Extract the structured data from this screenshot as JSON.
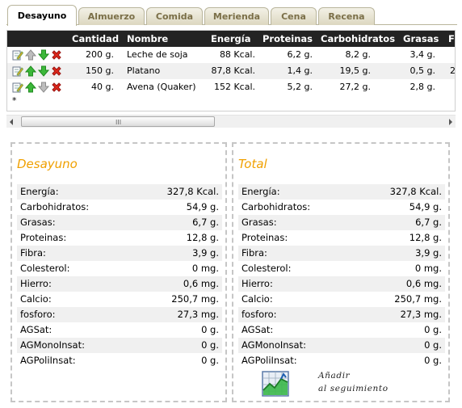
{
  "tabs": [
    {
      "label": "Desayuno",
      "active": true
    },
    {
      "label": "Almuerzo",
      "active": false
    },
    {
      "label": "Comida",
      "active": false
    },
    {
      "label": "Merienda",
      "active": false
    },
    {
      "label": "Cena",
      "active": false
    },
    {
      "label": "Recena",
      "active": false
    }
  ],
  "grid": {
    "columns": [
      "Cantidad",
      "Nombre",
      "Energía",
      "Proteinas",
      "Carbohidratos",
      "Grasas",
      "F"
    ],
    "rows": [
      {
        "cantidad": "200 g.",
        "nombre": "Leche de soja",
        "energia": "88 Kcal.",
        "proteinas": "6,2 g.",
        "carbohidratos": "8,2 g.",
        "grasas": "3,4 g.",
        "extra": "",
        "up_enabled": false,
        "down_enabled": true
      },
      {
        "cantidad": "150 g.",
        "nombre": "Platano",
        "energia": "87,8 Kcal.",
        "proteinas": "1,4 g.",
        "carbohidratos": "19,5 g.",
        "grasas": "0,5 g.",
        "extra": "2",
        "up_enabled": true,
        "down_enabled": true
      },
      {
        "cantidad": "40 g.",
        "nombre": "Avena (Quaker)",
        "energia": "152 Kcal.",
        "proteinas": "5,2 g.",
        "carbohidratos": "27,2 g.",
        "grasas": "2,8 g.",
        "extra": "",
        "up_enabled": true,
        "down_enabled": false
      }
    ],
    "new_row_marker": "*",
    "scroll_grip": "III",
    "icons": [
      "edit-icon",
      "arrow-up-icon",
      "arrow-down-icon",
      "delete-icon"
    ]
  },
  "summary_meal": {
    "title": "Desayuno",
    "rows": [
      {
        "label": "Energía:",
        "value": "327,8 Kcal."
      },
      {
        "label": "Carbohidratos:",
        "value": "54,9 g."
      },
      {
        "label": "Grasas:",
        "value": "6,7 g."
      },
      {
        "label": "Proteinas:",
        "value": "12,8 g."
      },
      {
        "label": "Fibra:",
        "value": "3,9 g."
      },
      {
        "label": "Colesterol:",
        "value": "0 mg."
      },
      {
        "label": "Hierro:",
        "value": "0,6 mg."
      },
      {
        "label": "Calcio:",
        "value": "250,7 mg."
      },
      {
        "label": "fosforo:",
        "value": "27,3 mg."
      },
      {
        "label": "AGSat:",
        "value": "0 g."
      },
      {
        "label": "AGMonoInsat:",
        "value": "0 g."
      },
      {
        "label": "AGPoliInsat:",
        "value": "0 g."
      }
    ]
  },
  "summary_total": {
    "title": "Total",
    "rows": [
      {
        "label": "Energía:",
        "value": "327,8 Kcal."
      },
      {
        "label": "Carbohidratos:",
        "value": "54,9 g."
      },
      {
        "label": "Grasas:",
        "value": "6,7 g."
      },
      {
        "label": "Proteinas:",
        "value": "12,8 g."
      },
      {
        "label": "Fibra:",
        "value": "3,9 g."
      },
      {
        "label": "Colesterol:",
        "value": "0 mg."
      },
      {
        "label": "Hierro:",
        "value": "0,6 mg."
      },
      {
        "label": "Calcio:",
        "value": "250,7 mg."
      },
      {
        "label": "fosforo:",
        "value": "27,3 mg."
      },
      {
        "label": "AGSat:",
        "value": "0 g."
      },
      {
        "label": "AGMonoInsat:",
        "value": "0 g."
      },
      {
        "label": "AGPoliInsat:",
        "value": "0 g."
      }
    ]
  },
  "tracking": {
    "line1": "Añadir",
    "line2": "al seguimiento",
    "icon": "chart-icon"
  },
  "colors": {
    "title_orange": "#f0a000",
    "header_dark": "#232323",
    "row_alt": "#f0f0f0"
  }
}
